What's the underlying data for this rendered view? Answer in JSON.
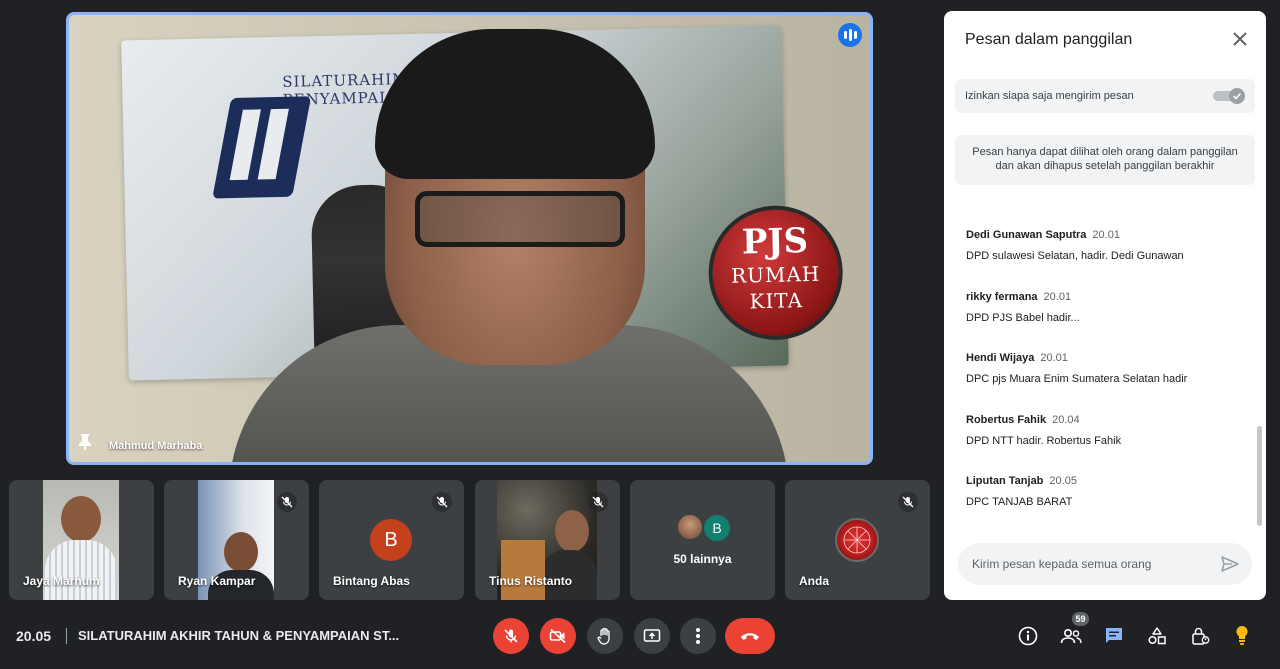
{
  "main_speaker": {
    "name": "Mahmud Marhaba",
    "banner_line1": "SILATURAHIM",
    "banner_line2": "PENYAMPAIAN",
    "badge_big": "PJS",
    "badge_line1": "RUMAH",
    "badge_line2": "KITA",
    "logo_text": "PJS"
  },
  "participants": [
    {
      "name": "Jaya Marhum",
      "muted": false
    },
    {
      "name": "Ryan Kampar",
      "muted": true
    },
    {
      "name": "Bintang Abas",
      "muted": true,
      "initial": "B"
    },
    {
      "name": "Tinus Ristanto",
      "muted": true
    },
    {
      "name": "50 lainnya",
      "initial": "B"
    },
    {
      "name": "Anda",
      "muted": true
    }
  ],
  "chat": {
    "title": "Pesan dalam panggilan",
    "permission_label": "Izinkan siapa saja mengirim pesan",
    "info_line1": "Pesan hanya dapat dilihat oleh orang dalam panggilan",
    "info_line2": "dan akan dihapus setelah panggilan berakhir",
    "messages": [
      {
        "sender": "Dedi Gunawan Saputra",
        "time": "20.01",
        "text": "DPD sulawesi Selatan, hadir. Dedi Gunawan"
      },
      {
        "sender": "rikky fermana",
        "time": "20.01",
        "text": "DPD PJS Babel hadir..."
      },
      {
        "sender": "Hendi Wijaya",
        "time": "20.01",
        "text": "DPC pjs Muara Enim Sumatera Selatan hadir"
      },
      {
        "sender": "Robertus Fahik",
        "time": "20.04",
        "text": "DPD NTT hadir. Robertus Fahik"
      },
      {
        "sender": "Liputan Tanjab",
        "time": "20.05",
        "text": "DPC TANJAB BARAT"
      }
    ],
    "input_placeholder": "Kirim pesan kepada semua orang"
  },
  "bottom_bar": {
    "time": "20.05",
    "meeting_title": "SILATURAHIM AKHIR TAHUN & PENYAMPAIAN ST...",
    "participant_count": "59"
  },
  "colors": {
    "background": "#202124",
    "tile": "#3c4043",
    "danger": "#ea4335",
    "accent_blue": "#1a73e8",
    "speaker_border": "#8ab4f8",
    "avatar_orange": "#c5411d",
    "avatar_teal": "#12806e",
    "activities_yellow": "#fbbc04"
  },
  "icons": {
    "speaking": "audio-level-icon",
    "pin": "pin-icon",
    "mute": "mic-off-icon",
    "close": "close-icon",
    "send": "send-icon"
  }
}
